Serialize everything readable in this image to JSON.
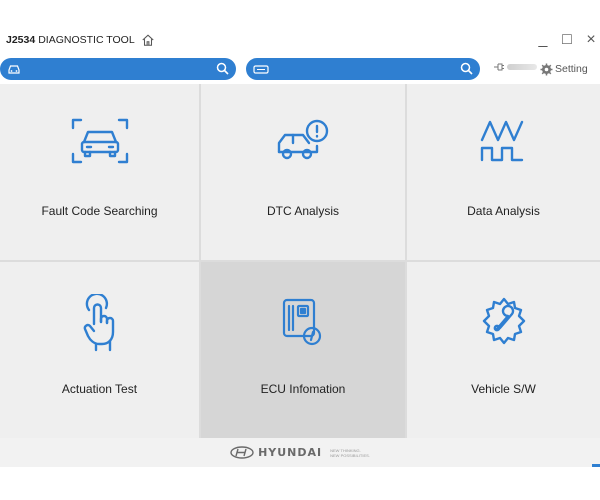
{
  "app": {
    "title_bold": "J2534",
    "title_rest": "DIAGNOSTIC TOOL",
    "window_controls": [
      "_",
      "□",
      "×"
    ]
  },
  "toolbar": {
    "search1_icon": "car-icon",
    "search2_icon": "keyboard-icon",
    "setting_label": "Setting"
  },
  "tiles": [
    {
      "label": "Fault Code Searching",
      "icon": "car-scan-icon"
    },
    {
      "label": "DTC Analysis",
      "icon": "car-alert-icon"
    },
    {
      "label": "Data Analysis",
      "icon": "waveform-icon"
    },
    {
      "label": "Actuation Test",
      "icon": "finger-tap-icon"
    },
    {
      "label": "ECU Infomation",
      "icon": "ecu-chip-icon",
      "selected": true
    },
    {
      "label": "Vehicle S/W",
      "icon": "gear-wrench-icon"
    }
  ],
  "footer": {
    "brand": "HYUNDAI",
    "tagline_line1": "NEW THINKING.",
    "tagline_line2": "NEW POSSIBILITIES."
  },
  "colors": {
    "accent": "#2f7fd1",
    "tile_bg": "#efefef",
    "tile_selected": "#d6d6d6"
  }
}
